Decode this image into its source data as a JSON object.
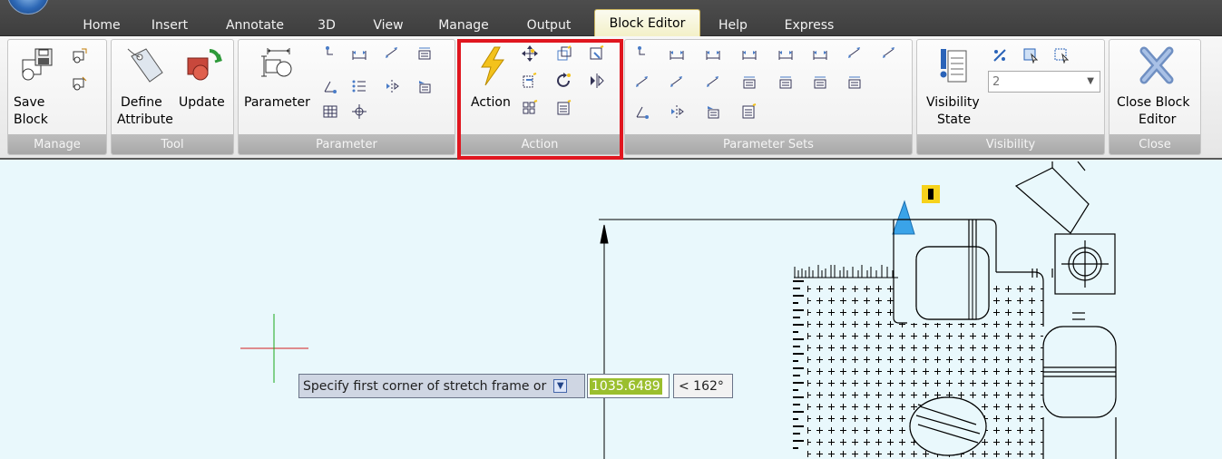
{
  "tabs": [
    {
      "label": "Home"
    },
    {
      "label": "Insert"
    },
    {
      "label": "Annotate"
    },
    {
      "label": "3D"
    },
    {
      "label": "View"
    },
    {
      "label": "Manage"
    },
    {
      "label": "Output"
    },
    {
      "label": "Block Editor",
      "active": true
    },
    {
      "label": "Help"
    },
    {
      "label": "Express"
    }
  ],
  "panels": {
    "manage": {
      "title": "Manage",
      "save_block": [
        "Save",
        "Block"
      ]
    },
    "tool": {
      "title": "Tool",
      "define_attribute": [
        "Define",
        "Attribute"
      ],
      "update": "Update"
    },
    "parameter": {
      "title": "Parameter",
      "parameter_button": "Parameter"
    },
    "action": {
      "title": "Action",
      "action_button": "Action"
    },
    "parameter_sets": {
      "title": "Parameter Sets"
    },
    "visibility": {
      "title": "Visibility",
      "visibility_state": [
        "Visibility",
        "State"
      ],
      "state_value": "2"
    },
    "close": {
      "title": "Close",
      "close_block_editor": [
        "Close Block",
        "Editor"
      ]
    }
  },
  "command_prompt": {
    "text": "Specify first corner of stretch frame or",
    "value": "1035.6489",
    "angle": "< 162°"
  },
  "colors": {
    "canvas_bg": "#e9f8fc",
    "highlight": "#e0161f",
    "ribbon_dark": "#3e3e3e",
    "active_tab": "#f3f0c8",
    "value_highlight": "#9bbf2e"
  }
}
